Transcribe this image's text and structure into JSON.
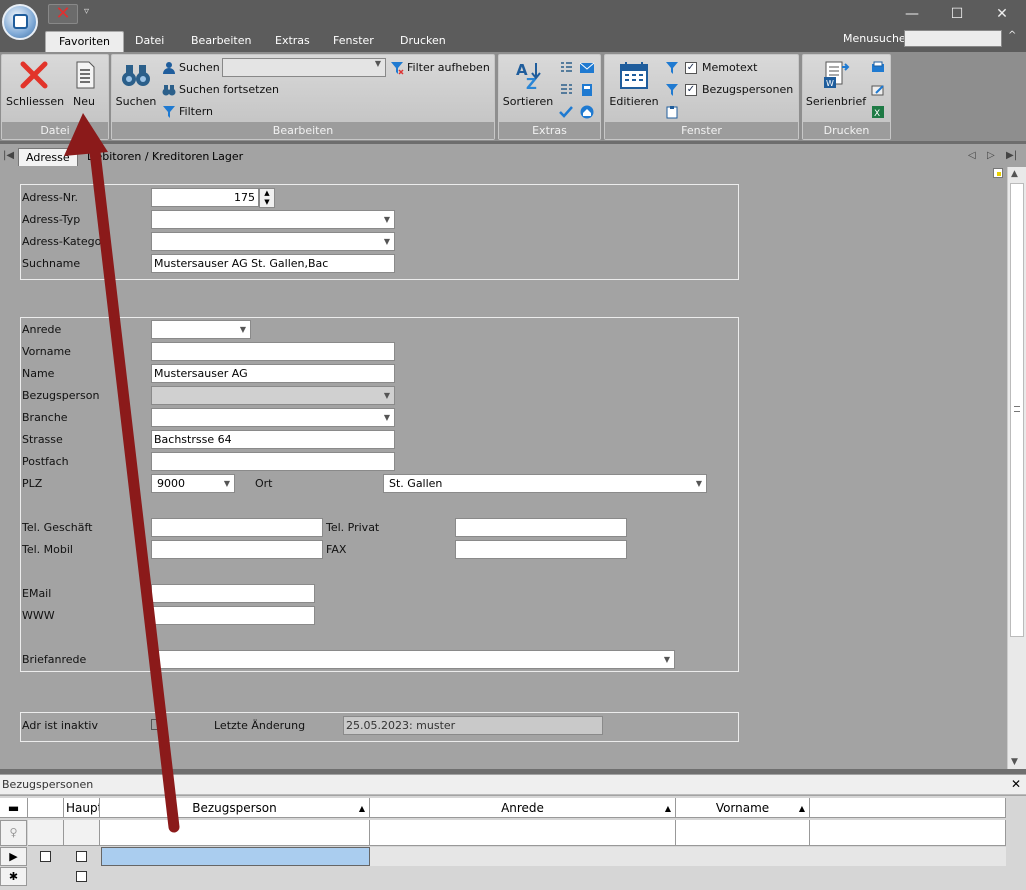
{
  "quick_access": {
    "more": "▿"
  },
  "window_controls": {
    "minimize": "—",
    "maximize": "☐",
    "close": "✕"
  },
  "ribbon_tabs": [
    "Favoriten",
    "Datei",
    "Bearbeiten",
    "Extras",
    "Fenster",
    "Drucken"
  ],
  "menusuche": {
    "label": "Menusuche",
    "value": ""
  },
  "ribbon": {
    "datei": {
      "caption": "Datei",
      "schliessen": "Schliessen",
      "neu": "Neu"
    },
    "bearbeiten": {
      "caption": "Bearbeiten",
      "suchen_big": "Suchen",
      "suchen": "Suchen",
      "suchen_fortsetzen": "Suchen fortsetzen",
      "filtern": "Filtern",
      "filter_aufheben": "Filter aufheben",
      "search_value": ""
    },
    "extras": {
      "caption": "Extras",
      "sortieren": "Sortieren"
    },
    "fenster": {
      "caption": "Fenster",
      "editieren": "Editieren",
      "memotext": "Memotext",
      "bezugspersonen": "Bezugspersonen",
      "memotext_checked": true,
      "bezugspersonen_checked": true
    },
    "drucken": {
      "caption": "Drucken",
      "serienbrief": "Serienbrief"
    }
  },
  "sub_tabs": [
    "Adresse",
    "Debitoren / Kreditoren",
    "Lager"
  ],
  "form": {
    "adress_nr": {
      "label": "Adress-Nr.",
      "value": "175"
    },
    "adress_typ": {
      "label": "Adress-Typ",
      "value": ""
    },
    "adress_kategorie": {
      "label": "Adress-Kategor",
      "value": ""
    },
    "suchname": {
      "label": "Suchname",
      "value": "Mustersauser AG St. Gallen,Bac"
    },
    "anrede": {
      "label": "Anrede",
      "value": ""
    },
    "vorname": {
      "label": "Vorname",
      "value": ""
    },
    "name": {
      "label": "Name",
      "value": "Mustersauser AG"
    },
    "bezugsperson": {
      "label": "Bezugsperson",
      "value": ""
    },
    "branche": {
      "label": "Branche",
      "value": ""
    },
    "strasse": {
      "label": "Strasse",
      "value": "Bachstrsse 64"
    },
    "postfach": {
      "label": "Postfach",
      "value": ""
    },
    "plz": {
      "label": "PLZ",
      "value": "9000"
    },
    "ort": {
      "label": "Ort",
      "value": "St. Gallen"
    },
    "tel_geschaeft": {
      "label": "Tel. Geschäft",
      "value": ""
    },
    "tel_privat": {
      "label": "Tel. Privat",
      "value": ""
    },
    "tel_mobil": {
      "label": "Tel. Mobil",
      "value": ""
    },
    "fax": {
      "label": "FAX",
      "value": ""
    },
    "email": {
      "label": "EMail",
      "value": ""
    },
    "www": {
      "label": "WWW",
      "value": ""
    },
    "briefanrede": {
      "label": "Briefanrede",
      "value": ""
    },
    "adr_inaktiv": {
      "label": "Adr ist inaktiv",
      "checked": false
    },
    "letzte_aenderung": {
      "label": "Letzte Änderung",
      "value": "25.05.2023: muster"
    }
  },
  "bezugspersonen": {
    "title": "Bezugspersonen",
    "close": "✕",
    "columns": {
      "haupt": "Haupt",
      "bezugsperson": "Bezugsperson",
      "anrede": "Anrede",
      "vorname": "Vorname"
    },
    "row_markers": {
      "current": "▶",
      "new": "✱"
    }
  },
  "colors": {
    "annotation_arrow": "#8b1a1a",
    "selection": "#aacdef"
  }
}
